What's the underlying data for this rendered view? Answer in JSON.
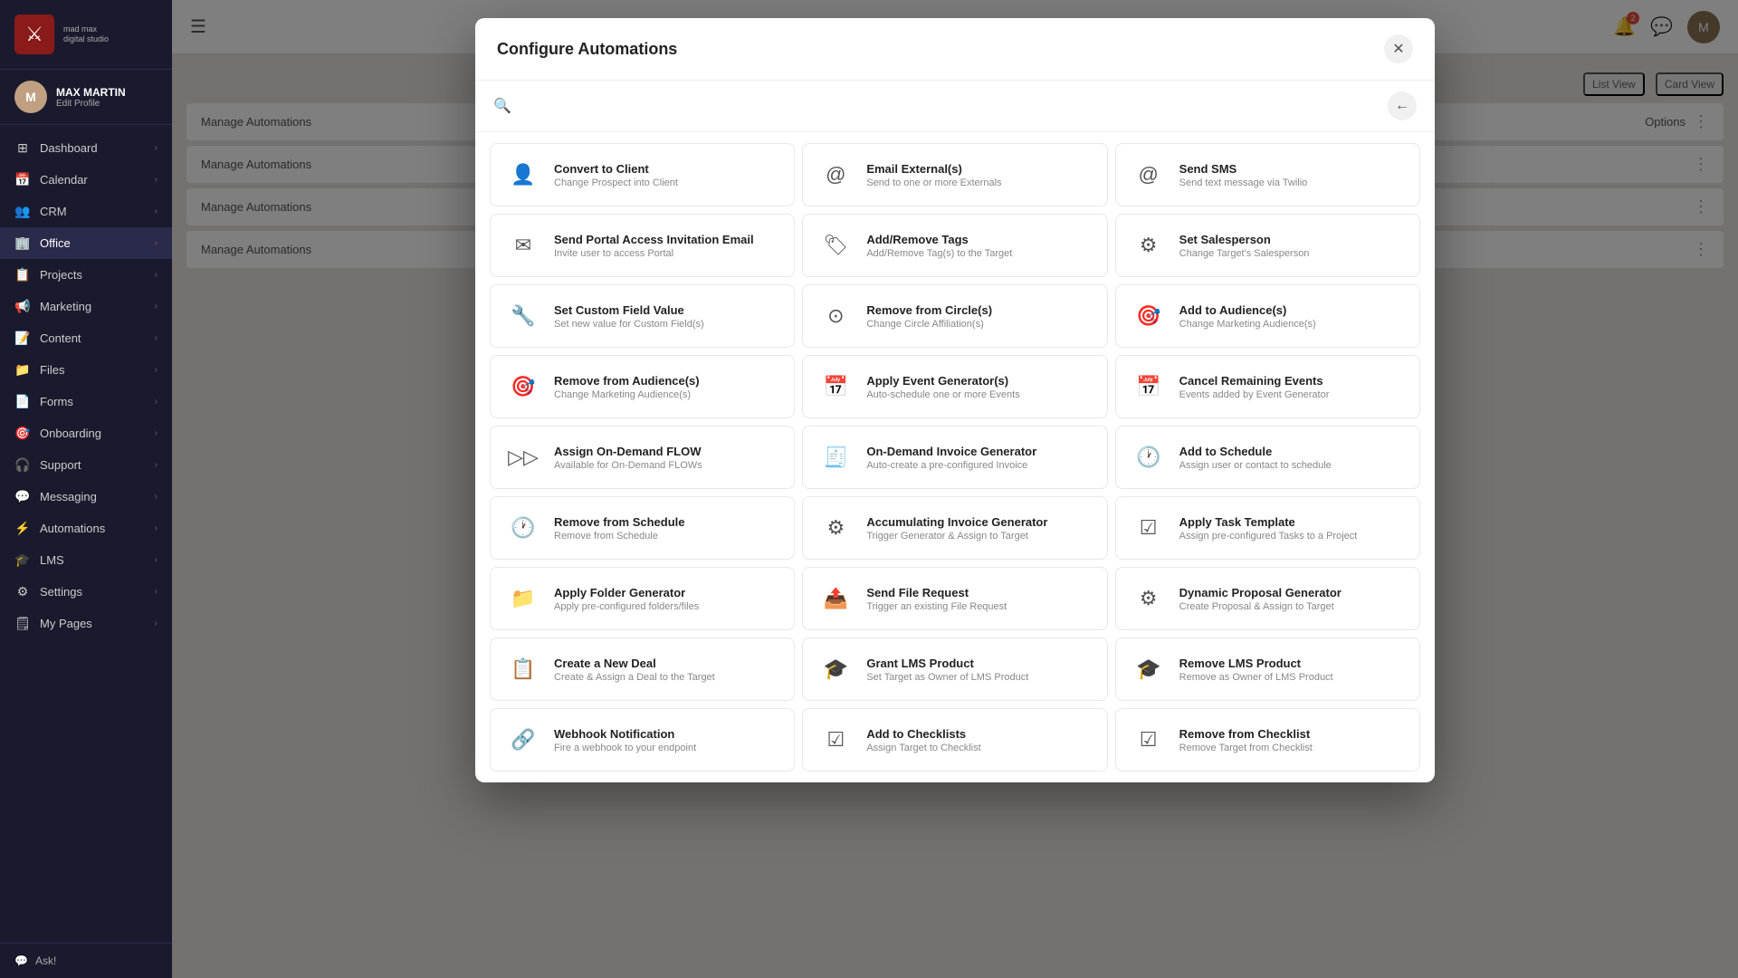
{
  "app": {
    "logo_icon": "⚔",
    "logo_name": "MAD MAX",
    "logo_sub": "digital studio"
  },
  "user": {
    "name": "MAX MARTIN",
    "edit_label": "Edit Profile",
    "initials": "M"
  },
  "sidebar": {
    "items": [
      {
        "id": "dashboard",
        "label": "Dashboard",
        "icon": "⊞",
        "has_chevron": true
      },
      {
        "id": "calendar",
        "label": "Calendar",
        "icon": "📅",
        "has_chevron": true
      },
      {
        "id": "crm",
        "label": "CRM",
        "icon": "👥",
        "has_chevron": true
      },
      {
        "id": "office",
        "label": "Office",
        "icon": "🏢",
        "has_chevron": true,
        "active": true
      },
      {
        "id": "projects",
        "label": "Projects",
        "icon": "📋",
        "has_chevron": true
      },
      {
        "id": "marketing",
        "label": "Marketing",
        "icon": "📢",
        "has_chevron": true
      },
      {
        "id": "content",
        "label": "Content",
        "icon": "📝",
        "has_chevron": true
      },
      {
        "id": "files",
        "label": "Files",
        "icon": "📁",
        "has_chevron": true
      },
      {
        "id": "forms",
        "label": "Forms",
        "icon": "📄",
        "has_chevron": true
      },
      {
        "id": "onboarding",
        "label": "Onboarding",
        "icon": "🎯",
        "has_chevron": true
      },
      {
        "id": "support",
        "label": "Support",
        "icon": "🎧",
        "has_chevron": true
      },
      {
        "id": "messaging",
        "label": "Messaging",
        "icon": "💬",
        "has_chevron": true
      },
      {
        "id": "automations",
        "label": "Automations",
        "icon": "⚡",
        "has_chevron": true
      },
      {
        "id": "lms",
        "label": "LMS",
        "icon": "🎓",
        "has_chevron": true
      },
      {
        "id": "settings",
        "label": "Settings",
        "icon": "⚙",
        "has_chevron": true
      },
      {
        "id": "my-pages",
        "label": "My Pages",
        "icon": "🗒",
        "has_chevron": true
      }
    ],
    "ask_label": "Ask!"
  },
  "topbar": {
    "notification_count": "2",
    "list_view_label": "List View",
    "card_view_label": "Card View",
    "options_label": "Options"
  },
  "modal": {
    "title": "Configure Automations",
    "close_icon": "✕",
    "back_icon": "←",
    "search_placeholder": "",
    "automations": [
      {
        "id": "convert-to-client",
        "title": "Convert to Client",
        "description": "Change Prospect into Client",
        "icon": "👤"
      },
      {
        "id": "email-externals",
        "title": "Email External(s)",
        "description": "Send to one or more Externals",
        "icon": "@"
      },
      {
        "id": "send-sms",
        "title": "Send SMS",
        "description": "Send text message via Twilio",
        "icon": "@"
      },
      {
        "id": "send-portal-invitation",
        "title": "Send Portal Access Invitation Email",
        "description": "Invite user to access Portal",
        "icon": "✉"
      },
      {
        "id": "add-remove-tags",
        "title": "Add/Remove Tags",
        "description": "Add/Remove Tag(s) to the Target",
        "icon": "🏷"
      },
      {
        "id": "set-salesperson",
        "title": "Set Salesperson",
        "description": "Change Target's Salesperson",
        "icon": "⚙"
      },
      {
        "id": "set-custom-field",
        "title": "Set Custom Field Value",
        "description": "Set new value for Custom Field(s)",
        "icon": "🔧"
      },
      {
        "id": "remove-from-circles",
        "title": "Remove from Circle(s)",
        "description": "Change Circle Affiliation(s)",
        "icon": "⊙"
      },
      {
        "id": "add-to-audiences",
        "title": "Add to Audience(s)",
        "description": "Change Marketing Audience(s)",
        "icon": "🎯"
      },
      {
        "id": "remove-from-audiences",
        "title": "Remove from Audience(s)",
        "description": "Change Marketing Audience(s)",
        "icon": "🎯"
      },
      {
        "id": "apply-event-generator",
        "title": "Apply Event Generator(s)",
        "description": "Auto-schedule one or more Events",
        "icon": "📅"
      },
      {
        "id": "cancel-remaining-events",
        "title": "Cancel Remaining Events",
        "description": "Events added by Event Generator",
        "icon": "📅"
      },
      {
        "id": "assign-on-demand-flow",
        "title": "Assign On-Demand FLOW",
        "description": "Available for On-Demand FLOWs",
        "icon": "▷▷"
      },
      {
        "id": "on-demand-invoice-generator",
        "title": "On-Demand Invoice Generator",
        "description": "Auto-create a pre-configured Invoice",
        "icon": "🧾"
      },
      {
        "id": "add-to-schedule",
        "title": "Add to Schedule",
        "description": "Assign user or contact to schedule",
        "icon": "🕐"
      },
      {
        "id": "remove-from-schedule",
        "title": "Remove from Schedule",
        "description": "Remove from Schedule",
        "icon": "🕐"
      },
      {
        "id": "accumulating-invoice-generator",
        "title": "Accumulating Invoice Generator",
        "description": "Trigger Generator & Assign to Target",
        "icon": "⚙"
      },
      {
        "id": "apply-task-template",
        "title": "Apply Task Template",
        "description": "Assign pre-configured Tasks to a Project",
        "icon": "☑"
      },
      {
        "id": "apply-folder-generator",
        "title": "Apply Folder Generator",
        "description": "Apply pre-configured folders/files",
        "icon": "📁"
      },
      {
        "id": "send-file-request",
        "title": "Send File Request",
        "description": "Trigger an existing File Request",
        "icon": "📤"
      },
      {
        "id": "dynamic-proposal-generator",
        "title": "Dynamic Proposal Generator",
        "description": "Create Proposal & Assign to Target",
        "icon": "⚙"
      },
      {
        "id": "create-new-deal",
        "title": "Create a New Deal",
        "description": "Create & Assign a Deal to the Target",
        "icon": "📋"
      },
      {
        "id": "grant-lms-product",
        "title": "Grant LMS Product",
        "description": "Set Target as Owner of LMS Product",
        "icon": "🎓"
      },
      {
        "id": "remove-lms-product",
        "title": "Remove LMS Product",
        "description": "Remove as Owner of LMS Product",
        "icon": "🎓"
      },
      {
        "id": "webhook-notification",
        "title": "Webhook Notification",
        "description": "Fire a webhook to your endpoint",
        "icon": "🔗"
      },
      {
        "id": "add-to-checklists",
        "title": "Add to Checklists",
        "description": "Assign Target to Checklist",
        "icon": "☑"
      },
      {
        "id": "remove-from-checklist",
        "title": "Remove from Checklist",
        "description": "Remove Target from Checklist",
        "icon": "☑"
      }
    ]
  },
  "bg_rows": [
    {
      "label": "Manage Automations",
      "id": "row1"
    },
    {
      "label": "Manage Automations",
      "id": "row2"
    },
    {
      "label": "Manage Automations",
      "id": "row3"
    },
    {
      "label": "Manage Automations",
      "id": "row4"
    }
  ]
}
